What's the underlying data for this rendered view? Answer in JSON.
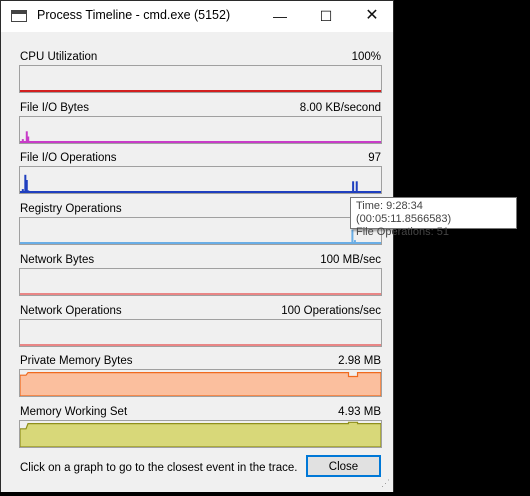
{
  "window": {
    "title": "Process Timeline - cmd.exe (5152)",
    "minimize": "—",
    "maximize": "☐",
    "close": "✕"
  },
  "graphs": [
    {
      "label": "CPU Utilization",
      "value": "100%",
      "color": "#d21f1f",
      "type": "line",
      "spikes": []
    },
    {
      "label": "File I/O Bytes",
      "value": "8.00 KB/second",
      "color": "#c83cc8",
      "type": "spikes",
      "spikes": [
        [
          0.5,
          0.15
        ],
        [
          1.3,
          0.05
        ],
        [
          1.6,
          0.45
        ],
        [
          2.0,
          0.25
        ]
      ]
    },
    {
      "label": "File I/O Operations",
      "value": "97",
      "color": "#1f3fbf",
      "type": "spikes",
      "spikes": [
        [
          0.5,
          0.15
        ],
        [
          1.2,
          0.7
        ],
        [
          1.6,
          0.5
        ],
        [
          2.0,
          0.1
        ],
        [
          92.0,
          0.45
        ],
        [
          93.0,
          0.45
        ]
      ]
    },
    {
      "label": "Registry Operations",
      "value": "",
      "color": "#6aaee6",
      "type": "spikes",
      "spikes": [
        [
          91.8,
          0.55
        ],
        [
          92.5,
          0.15
        ]
      ]
    },
    {
      "label": "Network Bytes",
      "value": "100 MB/sec",
      "color": "#e98686",
      "type": "line",
      "spikes": []
    },
    {
      "label": "Network Operations",
      "value": "100 Operations/sec",
      "color": "#e98686",
      "type": "line",
      "spikes": []
    },
    {
      "label": "Private Memory Bytes",
      "value": "2.98 MB",
      "color": "#f06a1e",
      "fill": "#fbbf9e",
      "type": "area",
      "level": 0.9,
      "startLevel": 0.8,
      "dip": 0.75
    },
    {
      "label": "Memory Working Set",
      "value": "4.93 MB",
      "color": "#8f8f1c",
      "fill": "#d8d879",
      "type": "area",
      "level": 0.9,
      "startLevel": 0.7,
      "dip": 0.95
    }
  ],
  "tooltip": {
    "time": "Time: 9:28:34 (00:05:11.8566583)",
    "ops": "File Operations: 51"
  },
  "hint": "Click on a graph to go to the closest event in the trace.",
  "close_button": "Close"
}
